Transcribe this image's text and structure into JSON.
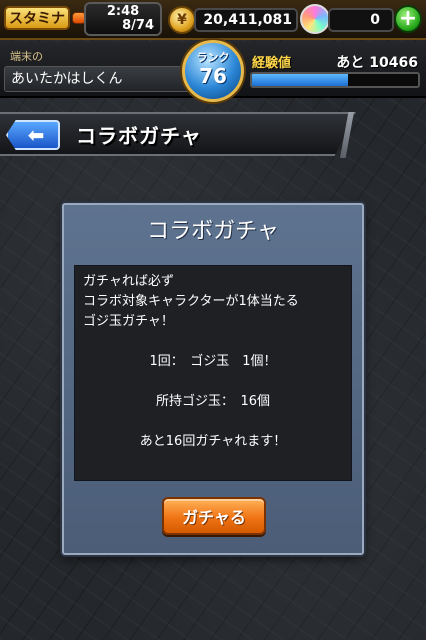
{
  "status": {
    "stamina_label": "スタミナ",
    "stamina_timer": "2:48",
    "stamina_count": "8/74",
    "gold_amount": "20,411,081",
    "orb_count": "0",
    "add_orb_label": "+",
    "gold_icon": "gold-coin-icon",
    "orb_icon": "rainbow-orb-icon"
  },
  "player": {
    "device_label": "端末の",
    "name": "あいたかはしくん",
    "rank_label": "ランク",
    "rank_value": "76",
    "exp_label": "経験値",
    "exp_remaining": "あと 10466",
    "exp_fill_fraction": 0.58
  },
  "header": {
    "back_icon": "back-arrow-icon",
    "back_label": "⬅",
    "title": "コラボガチャ"
  },
  "dialog": {
    "title": "コラボガチャ",
    "intro_lines": [
      "ガチャれば必ず",
      "コラボ対象キャラクターが1体当たる",
      "ゴジ玉ガチャ！"
    ],
    "cost_line": "1回：　ゴジ玉　1個！",
    "owned_line": "所持ゴジ玉：　16個",
    "remaining_line": "あと16回ガチャれます！",
    "button_label": "ガチャる"
  },
  "colors": {
    "accent_orange": "#f07414",
    "dialog_blue": "#5e738f",
    "exp_blue": "#1a6fd0",
    "stamina_gold": "#d99a14"
  }
}
